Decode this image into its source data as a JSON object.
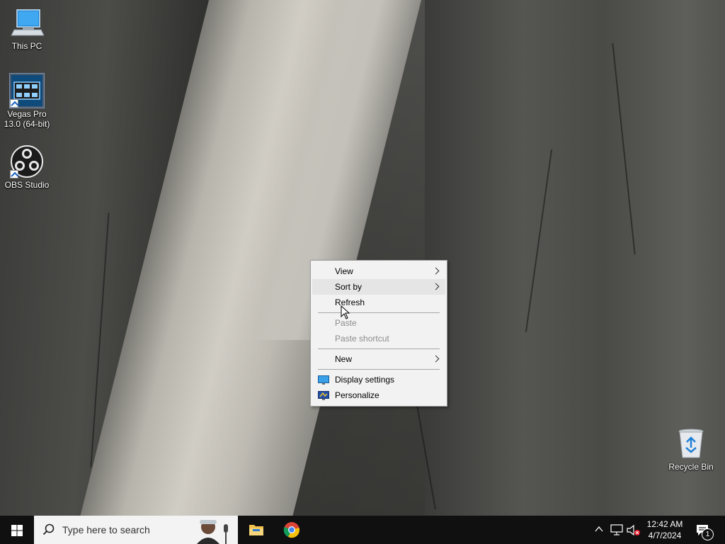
{
  "desktop": {
    "icons": [
      {
        "label": "This PC"
      },
      {
        "label": "Vegas Pro 13.0 (64-bit)"
      },
      {
        "label": "OBS Studio"
      },
      {
        "label": "Recycle Bin"
      }
    ]
  },
  "context_menu": {
    "items": [
      {
        "label": "View",
        "submenu": true
      },
      {
        "label": "Sort by",
        "submenu": true
      },
      {
        "label": "Refresh"
      },
      {
        "label": "Paste",
        "disabled": true
      },
      {
        "label": "Paste shortcut",
        "disabled": true
      },
      {
        "label": "New",
        "submenu": true
      },
      {
        "label": "Display settings",
        "icon": "display-settings-icon"
      },
      {
        "label": "Personalize",
        "icon": "personalize-icon"
      }
    ]
  },
  "taskbar": {
    "search_placeholder": "Type here to search",
    "pinned": [
      "file-explorer-icon",
      "chrome-icon"
    ],
    "clock": {
      "time": "12:42 AM",
      "date": "4/7/2024"
    },
    "notification_count": "1"
  },
  "colors": {
    "taskbar_bg": "#101010",
    "menu_bg": "#f2f2f2",
    "menu_hover": "#e5e5e5",
    "disabled_text": "#8c8c8c",
    "accent_blue": "#0078d7"
  }
}
